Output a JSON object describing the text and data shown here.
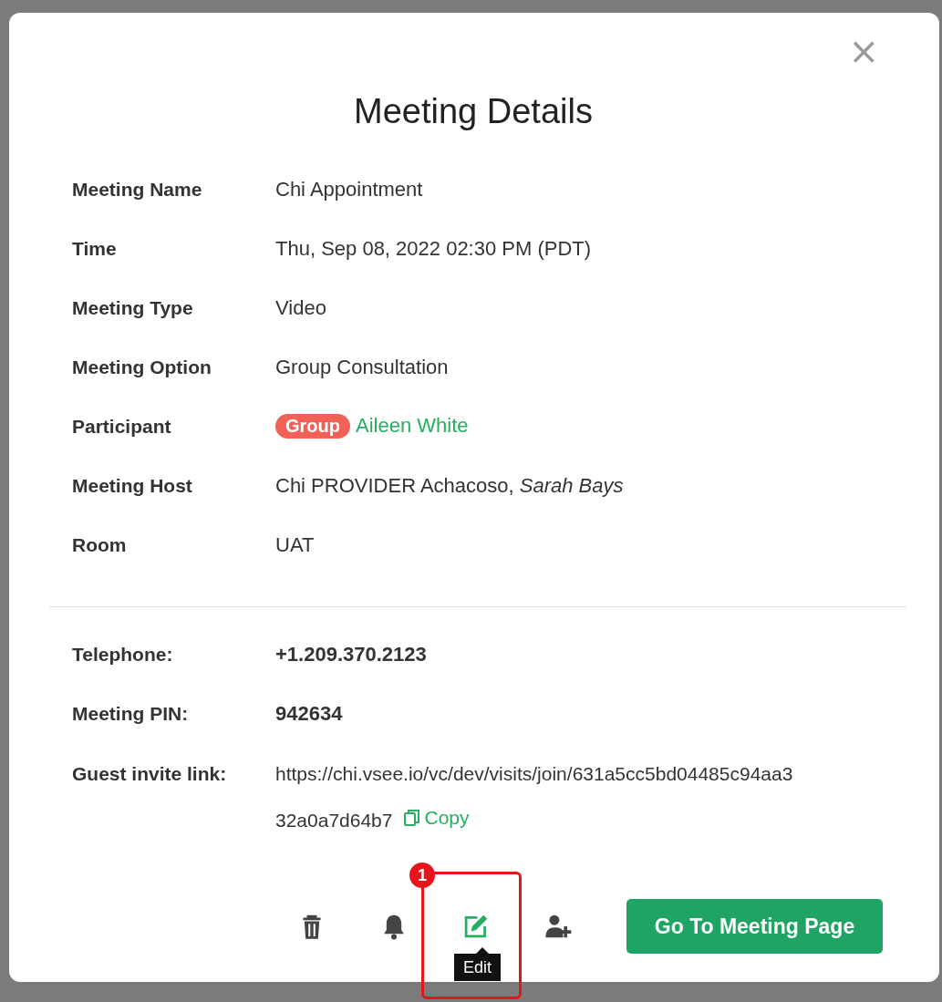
{
  "dialog": {
    "title": "Meeting Details",
    "close": "×"
  },
  "details": [
    {
      "kind": "text",
      "label": "Meeting Name",
      "value": "Chi Appointment"
    },
    {
      "kind": "text",
      "label": "Time",
      "value": "Thu, Sep 08, 2022 02:30 PM (PDT)"
    },
    {
      "kind": "text",
      "label": "Meeting Type",
      "value": "Video"
    },
    {
      "kind": "text",
      "label": "Meeting Option",
      "value": "Group Consultation"
    },
    {
      "kind": "participant",
      "label": "Participant",
      "tag": "Group",
      "value": "Aileen White"
    },
    {
      "kind": "text",
      "label": "Meeting Host",
      "value": "Chi PROVIDER Achacoso, *Sarah Bays*"
    },
    {
      "kind": "text",
      "label": "Room",
      "value": "UAT"
    }
  ],
  "dial_in": [
    {
      "kind": "bold",
      "label": "Telephone:",
      "value": "+1.209.370.2123"
    },
    {
      "kind": "bold",
      "label": "Meeting PIN:",
      "value": "942634"
    },
    {
      "kind": "link",
      "label": "Guest invite link:",
      "value_lines": [
        "https://chi.vsee.io/vc/dev/visits/join/631a5cc5bd04485c94aa3",
        "32a0a7d64b7"
      ],
      "action": "Copy"
    }
  ],
  "actions": [
    {
      "kind": "trash",
      "active": false
    },
    {
      "kind": "bell",
      "active": false
    },
    {
      "kind": "edit",
      "active": true,
      "tooltip": "Edit",
      "callout": "1"
    },
    {
      "kind": "add-person",
      "active": false
    }
  ],
  "primary_button": "Go To Meeting Page"
}
